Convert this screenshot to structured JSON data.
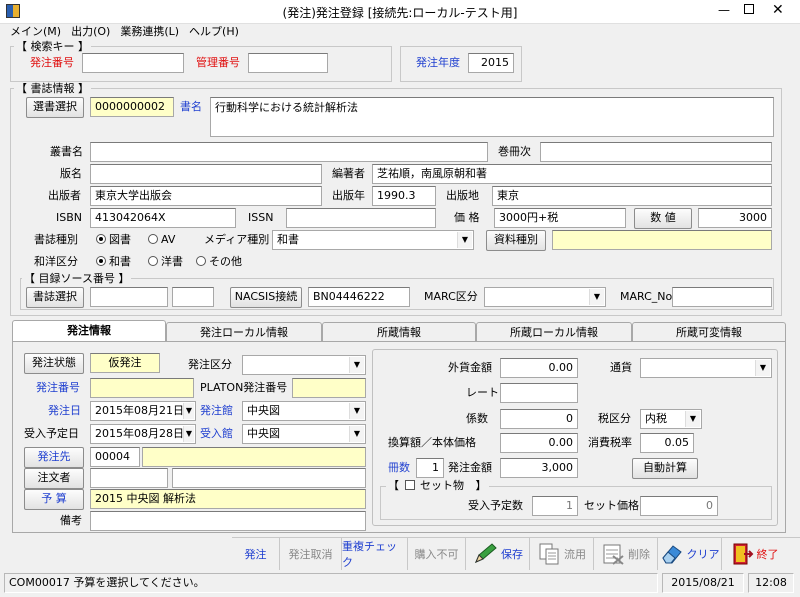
{
  "window": {
    "title": "(発注)発注登録 [接続先:ローカル-テスト用]"
  },
  "menu": [
    "メイン(M)",
    "出力(O)",
    "業務連携(L)",
    "ヘルプ(H)"
  ],
  "search": {
    "title": "【 検索キー 】",
    "order_no_label": "発注番号",
    "order_no": "",
    "mgmt_no_label": "管理番号",
    "mgmt_no": "",
    "year_label": "発注年度",
    "year": "2015"
  },
  "book": {
    "title": "【 書誌情報 】",
    "select_btn": "選書選択",
    "id": "0000000002",
    "title_label": "書名",
    "title_value": "行動科学における統計解析法",
    "series_label": "叢書名",
    "series": "",
    "volume_label": "巻冊次",
    "volume": "",
    "edition_label": "版名",
    "edition": "",
    "author_label": "編著者",
    "author": "芝祐順，南風原朝和著",
    "publisher_label": "出版者",
    "publisher": "東京大学出版会",
    "pubyear_label": "出版年",
    "pubyear": "1990.3",
    "place_label": "出版地",
    "place": "東京",
    "isbn_label": "ISBN",
    "isbn": "413042064X",
    "issn_label": "ISSN",
    "issn": "",
    "price_label": "価 格",
    "price": "3000円+税",
    "num_btn": "数 値",
    "num_value": "3000",
    "kind_label": "書誌種別",
    "kind_opts": [
      "図書",
      "AV"
    ],
    "media_label": "メディア種別",
    "media": "和書",
    "material_btn": "資料種別",
    "material": "",
    "lang_label": "和洋区分",
    "lang_opts": [
      "和書",
      "洋書",
      "その他"
    ]
  },
  "source": {
    "title": "【 目録ソース番号 】",
    "select_btn": "書誌選択",
    "a": "",
    "b": "",
    "nacsis_btn": "NACSIS接続",
    "nacsis_value": "BN04446222",
    "marc_label": "MARC区分",
    "marc": "",
    "marcno_label": "MARC_No",
    "marcno": ""
  },
  "tabs": [
    "発注情報",
    "発注ローカル情報",
    "所蔵情報",
    "所蔵ローカル情報",
    "所蔵可変情報"
  ],
  "order": {
    "status_btn": "発注状態",
    "status": "仮発注",
    "type_label": "発注区分",
    "type": "",
    "no_btn": "発注番号",
    "no": "",
    "platon_label": "PLATON発注番号",
    "platon": "",
    "date_btn": "発注日",
    "date": "2015年08月21日",
    "lib_btn": "発注館",
    "lib": "中央図",
    "due_label": "受入予定日",
    "due": "2015年08月28日",
    "recv_btn": "受入館",
    "recv_lib": "中央図",
    "vendor_btn": "発注先",
    "vendor_code": "00004",
    "vendor_name": "",
    "orderer_label": "注文者",
    "orderer": "",
    "orderer2": "",
    "budget_btn": "予 算",
    "budget": "2015 中央図 解析法",
    "memo_label": "備考",
    "memo": ""
  },
  "money": {
    "foreign_label": "外貨金額",
    "foreign": "0.00",
    "currency_label": "通貨",
    "currency": "",
    "rate_label": "レート",
    "rate": "",
    "coef_label": "係数",
    "coef": "0",
    "tax_label": "税区分",
    "tax": "内税",
    "conv_label": "換算額／本体価格",
    "conv": "0.00",
    "taxrate_label": "消費税率",
    "taxrate": "0.05",
    "count_label": "冊数",
    "count": "1",
    "amount_label": "発注金額",
    "amount": "3,000",
    "auto_btn": "自動計算",
    "set_title": "【",
    "set_label": "セット物",
    "set_close": "】",
    "due_count_label": "受入予定数",
    "due_count": "1",
    "set_price_label": "セット価格",
    "set_price": "0"
  },
  "toolbar": [
    "発注",
    "発注取消",
    "重複チェック",
    "購入不可",
    "保存",
    "流用",
    "削除",
    "クリア",
    "終了"
  ],
  "status": {
    "message": "COM00017 予算を選択してください。",
    "date": "2015/08/21",
    "time": "12:08"
  }
}
